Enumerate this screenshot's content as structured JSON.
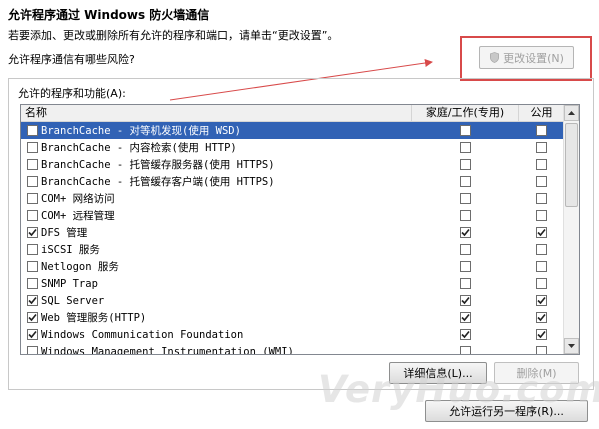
{
  "header": {
    "title": "允许程序通过 Windows 防火墙通信",
    "description": "若要添加、更改或删除所有允许的程序和端口，请单击“更改设置”。",
    "risk_link": "允许程序通信有哪些风险?",
    "change_settings_label": "更改设置(N)"
  },
  "group": {
    "label": "允许的程序和功能(A):"
  },
  "table": {
    "columns": [
      "名称",
      "家庭/工作(专用)",
      "公用"
    ],
    "rows": [
      {
        "name": "BranchCache - 对等机发现(使用 WSD)",
        "enabled": false,
        "home": false,
        "public": false,
        "selected": true
      },
      {
        "name": "BranchCache - 内容检索(使用 HTTP)",
        "enabled": false,
        "home": false,
        "public": false
      },
      {
        "name": "BranchCache - 托管缓存服务器(使用 HTTPS)",
        "enabled": false,
        "home": false,
        "public": false
      },
      {
        "name": "BranchCache - 托管缓存客户端(使用 HTTPS)",
        "enabled": false,
        "home": false,
        "public": false
      },
      {
        "name": "COM+ 网络访问",
        "enabled": false,
        "home": false,
        "public": false
      },
      {
        "name": "COM+ 远程管理",
        "enabled": false,
        "home": false,
        "public": false
      },
      {
        "name": "DFS 管理",
        "enabled": true,
        "home": true,
        "public": true
      },
      {
        "name": "iSCSI 服务",
        "enabled": false,
        "home": false,
        "public": false
      },
      {
        "name": "Netlogon 服务",
        "enabled": false,
        "home": false,
        "public": false
      },
      {
        "name": "SNMP Trap",
        "enabled": false,
        "home": false,
        "public": false
      },
      {
        "name": "SQL Server",
        "enabled": true,
        "home": true,
        "public": true
      },
      {
        "name": "Web 管理服务(HTTP)",
        "enabled": true,
        "home": true,
        "public": true
      },
      {
        "name": "Windows Communication Foundation",
        "enabled": true,
        "home": true,
        "public": true
      },
      {
        "name": "Windows Management Instrumentation (WMI)",
        "enabled": false,
        "home": false,
        "public": false
      }
    ]
  },
  "buttons": {
    "details": "详细信息(L)...",
    "remove": "删除(M)",
    "allow_another": "允许运行另一程序(R)..."
  },
  "watermark": "VeryHuo.com",
  "colors": {
    "selection": "#3162b5",
    "annotation_red": "#d84a4a"
  }
}
